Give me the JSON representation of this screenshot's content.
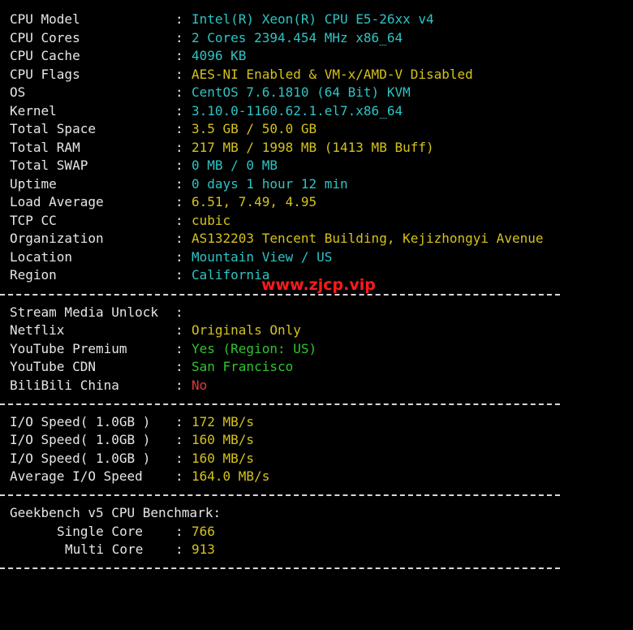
{
  "system": [
    {
      "label": "CPU Model",
      "value": "Intel(R) Xeon(R) CPU E5-26xx v4",
      "color": "#2ec4c4"
    },
    {
      "label": "CPU Cores",
      "value": "2 Cores 2394.454 MHz x86_64",
      "color": "#2ec4c4"
    },
    {
      "label": "CPU Cache",
      "value": "4096 KB",
      "color": "#2ec4c4"
    },
    {
      "label": "CPU Flags",
      "value": "AES-NI Enabled & VM-x/AMD-V Disabled",
      "color": "#d4c21c"
    },
    {
      "label": "OS",
      "value": "CentOS 7.6.1810 (64 Bit) KVM",
      "color": "#2ec4c4"
    },
    {
      "label": "Kernel",
      "value": "3.10.0-1160.62.1.el7.x86_64",
      "color": "#2ec4c4"
    },
    {
      "label": "Total Space",
      "value": "3.5 GB / 50.0 GB",
      "color": "#d4c21c"
    },
    {
      "label": "Total RAM",
      "value": "217 MB / 1998 MB (1413 MB Buff)",
      "color": "#d4c21c"
    },
    {
      "label": "Total SWAP",
      "value": "0 MB / 0 MB",
      "color": "#2ec4c4"
    },
    {
      "label": "Uptime",
      "value": "0 days 1 hour 12 min",
      "color": "#2ec4c4"
    },
    {
      "label": "Load Average",
      "value": "6.51, 7.49, 4.95",
      "color": "#d4c21c"
    },
    {
      "label": "TCP CC",
      "value": "cubic",
      "color": "#d4c21c"
    },
    {
      "label": "Organization",
      "value": "AS132203 Tencent Building, Kejizhongyi Avenue",
      "color": "#d4c21c"
    },
    {
      "label": "Location",
      "value": "Mountain View / US",
      "color": "#2ec4c4"
    },
    {
      "label": "Region",
      "value": "California",
      "color": "#2ec4c4"
    }
  ],
  "watermark": "www.zjcp.vip",
  "media": {
    "header": "Stream Media Unlock",
    "items": [
      {
        "label": "Netflix",
        "value": "Originals Only",
        "color": "#d4c21c"
      },
      {
        "label": "YouTube Premium",
        "value": "Yes (Region: US)",
        "color": "#2fc42f"
      },
      {
        "label": "YouTube CDN",
        "value": "San Francisco",
        "color": "#2fc42f"
      },
      {
        "label": "BiliBili China",
        "value": "No",
        "color": "#e03a3a"
      }
    ]
  },
  "io": [
    {
      "label": "I/O Speed( 1.0GB )",
      "value": "172 MB/s"
    },
    {
      "label": "I/O Speed( 1.0GB )",
      "value": "160 MB/s"
    },
    {
      "label": "I/O Speed( 1.0GB )",
      "value": "160 MB/s"
    },
    {
      "label": "Average I/O Speed",
      "value": "164.0 MB/s"
    }
  ],
  "io_color": "#d4c21c",
  "geekbench": {
    "header": "Geekbench v5 CPU Benchmark:",
    "single_label": "Single Core",
    "single_value": "766",
    "multi_label": "Multi Core",
    "multi_value": "913"
  },
  "separator": ":"
}
